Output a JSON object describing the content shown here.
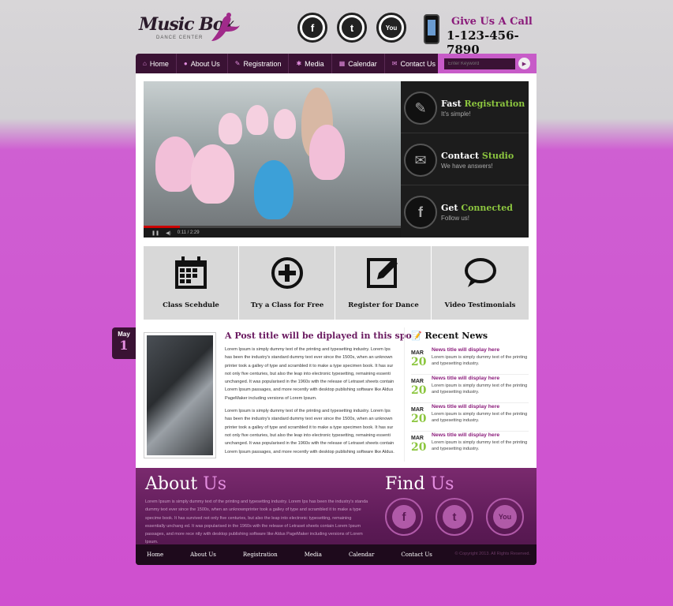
{
  "header": {
    "logo_text": "Music Box",
    "logo_sub": "DANCE CENTER",
    "social": [
      {
        "icon": "facebook-icon",
        "glyph": "f"
      },
      {
        "icon": "twitter-icon",
        "glyph": "t"
      },
      {
        "icon": "youtube-icon",
        "glyph": "You"
      }
    ],
    "call_label": "Give Us A Call",
    "phone": "1-123-456-7890"
  },
  "nav": {
    "items": [
      {
        "label": "Home",
        "icon": "home-icon"
      },
      {
        "label": "About Us",
        "icon": "info-icon"
      },
      {
        "label": "Registration",
        "icon": "pen-icon"
      },
      {
        "label": "Media",
        "icon": "gear-icon"
      },
      {
        "label": "Calendar",
        "icon": "calendar-icon"
      },
      {
        "label": "Contact Us",
        "icon": "mail-icon"
      }
    ],
    "search_placeholder": "Enter Keyword"
  },
  "video": {
    "time": "0:11 / 2:29"
  },
  "side": [
    {
      "a": "Fast",
      "b": "Registration",
      "sub": "It's simple!",
      "icon": "pen-icon"
    },
    {
      "a": "Contact",
      "b": "Studio",
      "sub": "We have answers!",
      "icon": "mail-icon"
    },
    {
      "a": "Get",
      "b": "Connected",
      "sub": "Follow us!",
      "icon": "facebook-icon"
    }
  ],
  "features": [
    {
      "label": "Class Scehdule",
      "icon": "calendar-icon"
    },
    {
      "label": "Try a Class for Free",
      "icon": "plus-circle-icon"
    },
    {
      "label": "Register for Dance",
      "icon": "edit-icon"
    },
    {
      "label": "Video Testimonials",
      "icon": "speech-bubble-icon"
    }
  ],
  "post": {
    "month": "May",
    "day": "1",
    "title": "A Post title will be diplayed in this spot!",
    "p1": "Lorem Ipsum is simply dummy text of the printing and typesetting industry. Lorem Ips has been the industry's standard dummy text ever since the 1500s, when an unknown printer took a galley of type and scrambled it to make a type specimen book. It has sur not only five centuries, but also the leap into electronic typesetting, remaining essenti unchanged. It was popularised in the 1960s with the release of Letraset sheets contain Lorem Ipsum passages, and more recently with desktop publishing software like Aldus PageMaker including versions of Lorem Ipsum.",
    "p2": "Lorem Ipsum is simply dummy text of the printing and typesetting industry. Lorem Ips has been the industry's standard dummy text ever since the 1500s, when an unknown printer took a galley of type and scrambled it to make a type specimen book. It has sur not only five centuries, but also the leap into electronic typesetting, remaining essenti unchanged. It was popularised in the 1960s with the release of Letraset sheets contain Lorem Ipsum passages, and more recently with desktop publishing software like Aldus."
  },
  "news": {
    "title": "Recent News",
    "items": [
      {
        "mo": "MAR",
        "dy": "20",
        "t": "News title will display here",
        "b": "Lorem ipsum is simply dummy text of the printing and typesetting industry."
      },
      {
        "mo": "MAR",
        "dy": "20",
        "t": "News title will display here",
        "b": "Lorem ipsum is simply dummy text of the printing and typesetting industry."
      },
      {
        "mo": "MAR",
        "dy": "20",
        "t": "News title will display here",
        "b": "Lorem ipsum is simply dummy text of the printing and typesetting industry."
      },
      {
        "mo": "MAR",
        "dy": "20",
        "t": "News title will display here",
        "b": "Lorem ipsum is simply dummy text of the printing and typesetting industry."
      }
    ]
  },
  "footer": {
    "about_a": "About",
    "about_b": "Us",
    "about_text": "Lorem Ipsum is simply dummy text of the printing and typesetting industry. Lorem Ips has been the industry's standa dummy text ever since the 1500s, when an unknownprinter took a galley of type and scrambled it to make a type specime book. It has survived not only five centuries, but also the leap into electronic typesetting, remaining essentially unchang ed. It was popularised in the 1960s with the release of Letraset sheets contain Lorem Ipsum passages, and more rece ntly with desktop publishing software like Aldus PageMaker including versions of Lorem Ipsum.",
    "find_a": "Find",
    "find_b": "Us",
    "links": [
      "Home",
      "About Us",
      "Registration",
      "Media",
      "Calendar",
      "Contact Us"
    ],
    "copyright": "© Copyright 2013. All Rights Reserved."
  },
  "colors": {
    "accent": "#8cc63f",
    "brand": "#3a1234",
    "pink": "#e48ee0"
  }
}
